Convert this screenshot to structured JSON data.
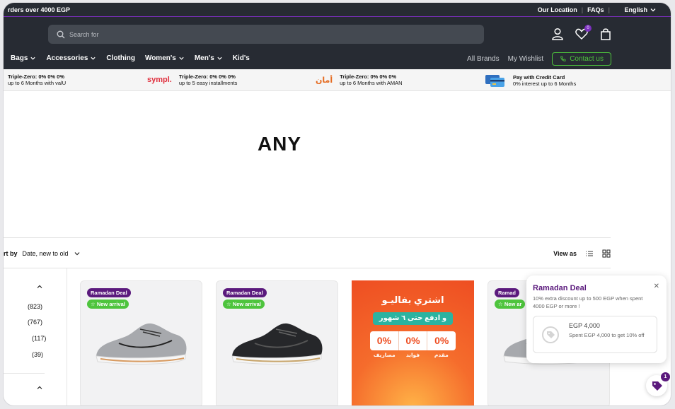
{
  "topbar": {
    "promo": "rders over 4000 EGP",
    "links": [
      "Our Location",
      "FAQs"
    ],
    "language": "English"
  },
  "header": {
    "search_placeholder": "Search for",
    "wishlist_count": "0"
  },
  "nav": {
    "items": [
      "Bags",
      "Accessories",
      "Clothing",
      "Women's",
      "Men's",
      "Kid's"
    ],
    "all_brands": "All Brands",
    "my_wishlist": "My Wishlist",
    "contact": "Contact us"
  },
  "payments": [
    {
      "title": "Triple-Zero: 0% 0% 0%",
      "sub": "up to 6 Months with valU"
    },
    {
      "logo": "sympl.",
      "title": "Triple-Zero: 0% 0% 0%",
      "sub": "up to 5 easy installments"
    },
    {
      "logo": "أمان",
      "title": "Triple-Zero: 0% 0% 0%",
      "sub": "up to 6 Months with AMAN"
    },
    {
      "title": "Pay with Credit Card",
      "sub": "0% interest up to 6 Months"
    }
  ],
  "page_title": "ANY",
  "sort": {
    "label": "rt by",
    "value": "Date, new to old",
    "view_as": "View as"
  },
  "filters": {
    "counts": [
      "(823)",
      "(767)",
      "(117)",
      "(39)"
    ]
  },
  "product_tags": {
    "deal": "Ramadan Deal",
    "new": "New arrival",
    "deal_partial": "Ramad",
    "new_partial": "New ar"
  },
  "banner": {
    "line1": "اشتري بفاليـو",
    "line2": "و ادفع حتى ٦ شهور",
    "percents": [
      "0%",
      "0%",
      "0%"
    ],
    "labels": [
      "مصاريف",
      "فوايد",
      "مقدم"
    ]
  },
  "popup": {
    "title": "Ramadan Deal",
    "description": "10% extra discount up to 500 EGP when spent 4000 EGP or more !",
    "amount": "EGP 4,000",
    "note": "Spent EGP 4,000 to get 10% off"
  },
  "fab": {
    "badge": "1"
  },
  "colors": {
    "header_bg": "#272b33",
    "accent_purple": "#5b1a7d",
    "accent_green": "#4ec43d"
  }
}
